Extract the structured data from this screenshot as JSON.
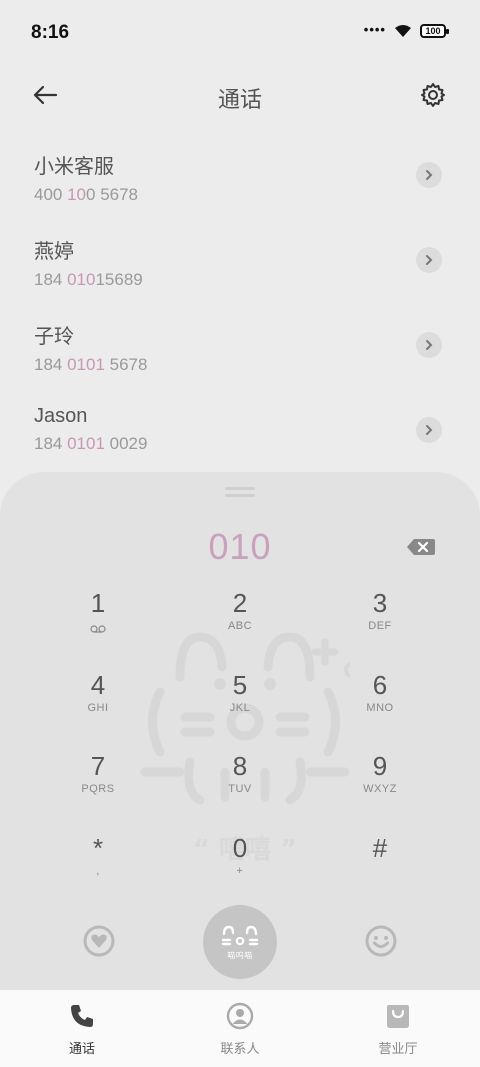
{
  "status_bar": {
    "time": "8:16",
    "signal": "••••",
    "battery": "100"
  },
  "header": {
    "title": "通话"
  },
  "contacts": [
    {
      "name": "小米客服",
      "number_pre": "400 ",
      "number_match": "10",
      "number_post": "0 5678"
    },
    {
      "name": "燕婷",
      "number_pre": "184 ",
      "number_match": "010",
      "number_post": "15689"
    },
    {
      "name": "子玲",
      "number_pre": "184 ",
      "number_match": "0101",
      "number_post": " 5678"
    },
    {
      "name": "Jason",
      "number_pre": "184 ",
      "number_match": "0101",
      "number_post": " 0029"
    }
  ],
  "dialer": {
    "input": "010",
    "keys": [
      {
        "digit": "1",
        "letters": ""
      },
      {
        "digit": "2",
        "letters": "ABC"
      },
      {
        "digit": "3",
        "letters": "DEF"
      },
      {
        "digit": "4",
        "letters": "GHI"
      },
      {
        "digit": "5",
        "letters": "JKL"
      },
      {
        "digit": "6",
        "letters": "MNO"
      },
      {
        "digit": "7",
        "letters": "PQRS"
      },
      {
        "digit": "8",
        "letters": "TUV"
      },
      {
        "digit": "9",
        "letters": "WXYZ"
      },
      {
        "digit": "*",
        "letters": ","
      },
      {
        "digit": "0",
        "letters": "+"
      },
      {
        "digit": "#",
        "letters": ""
      }
    ],
    "watermark_text": "“ 嘻嘻 ”",
    "call_button_caption": "喵呜喵"
  },
  "bottom_nav": [
    {
      "label": "通话",
      "icon": "phone-icon"
    },
    {
      "label": "联系人",
      "icon": "contact-icon"
    },
    {
      "label": "营业厅",
      "icon": "shop-bag-icon"
    }
  ],
  "colors": {
    "accent": "#c9a1bc",
    "background": "#ececec",
    "panel": "#e2e2e2"
  }
}
